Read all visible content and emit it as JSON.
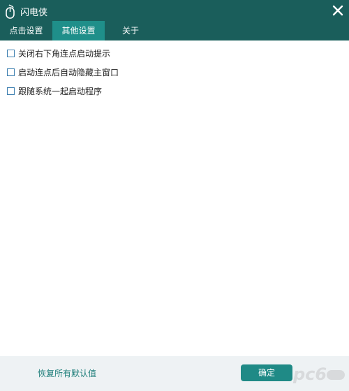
{
  "window": {
    "title": "闪电侠",
    "app_icon": "mouse-icon",
    "close_icon": "close-icon"
  },
  "tabs": [
    {
      "label": "点击设置",
      "active": false
    },
    {
      "label": "其他设置",
      "active": true
    },
    {
      "label": "关于",
      "active": false
    }
  ],
  "options": [
    {
      "label": "关闭右下角连点启动提示",
      "checked": false
    },
    {
      "label": "启动连点后自动隐藏主窗口",
      "checked": false
    },
    {
      "label": "跟随系统一起启动程序",
      "checked": false
    }
  ],
  "footer": {
    "restore_label": "恢复所有默认值",
    "ok_label": "确定"
  },
  "watermark": {
    "text": "pc6",
    "icon": "pc6-watermark-logo"
  },
  "colors": {
    "titlebar": "#1a5e5b",
    "active_tab": "#1f8f8a",
    "accent": "#1f8a86",
    "link": "#1e7e7a",
    "footer_bg": "#eef2f4"
  }
}
